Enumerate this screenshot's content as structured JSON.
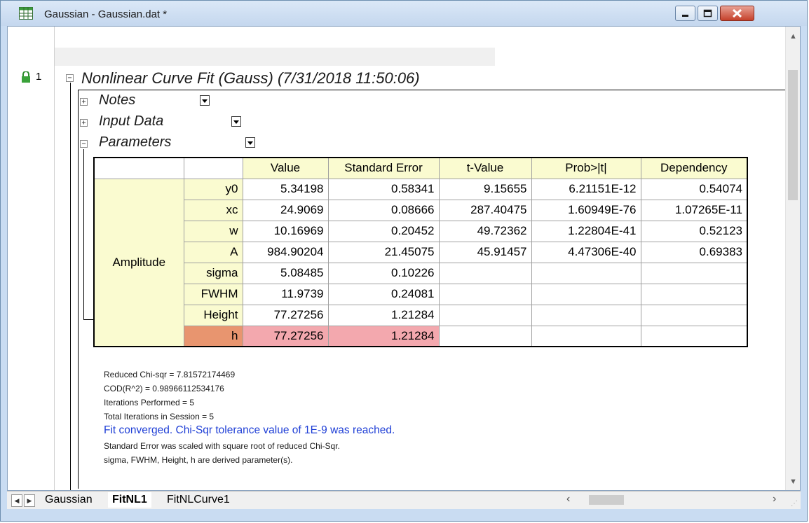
{
  "window": {
    "title": "Gaussian - Gaussian.dat *",
    "min_icon": "minimize-icon",
    "max_icon": "maximize-icon",
    "close_icon": "close-icon"
  },
  "report": {
    "row_number": "1",
    "heading": "Nonlinear Curve Fit (Gauss) (7/31/2018 11:50:06)",
    "sections": {
      "notes": "Notes",
      "input_data": "Input Data",
      "parameters": "Parameters"
    },
    "expand": "+",
    "collapse": "−"
  },
  "table": {
    "headers": [
      "Value",
      "Standard Error",
      "t-Value",
      "Prob>|t|",
      "Dependency"
    ],
    "category": "Amplitude",
    "rows": [
      {
        "name": "y0",
        "value": "5.34198",
        "stderr": "0.58341",
        "t": "9.15655",
        "prob": "6.21151E-12",
        "dep": "0.54074"
      },
      {
        "name": "xc",
        "value": "24.9069",
        "stderr": "0.08666",
        "t": "287.40475",
        "prob": "1.60949E-76",
        "dep": "1.07265E-11"
      },
      {
        "name": "w",
        "value": "10.16969",
        "stderr": "0.20452",
        "t": "49.72362",
        "prob": "1.22804E-41",
        "dep": "0.52123"
      },
      {
        "name": "A",
        "value": "984.90204",
        "stderr": "21.45075",
        "t": "45.91457",
        "prob": "4.47306E-40",
        "dep": "0.69383"
      },
      {
        "name": "sigma",
        "value": "5.08485",
        "stderr": "0.10226",
        "t": "",
        "prob": "",
        "dep": ""
      },
      {
        "name": "FWHM",
        "value": "11.9739",
        "stderr": "0.24081",
        "t": "",
        "prob": "",
        "dep": ""
      },
      {
        "name": "Height",
        "value": "77.27256",
        "stderr": "1.21284",
        "t": "",
        "prob": "",
        "dep": ""
      },
      {
        "name": "h",
        "value": "77.27256",
        "stderr": "1.21284",
        "t": "",
        "prob": "",
        "dep": ""
      }
    ]
  },
  "notes": {
    "line1": "Reduced Chi-sqr = 7.81572174469",
    "line2": "COD(R^2) = 0.98966112534176",
    "line3": "Iterations Performed = 5",
    "line4": "Total Iterations in Session = 5",
    "converged": "Fit converged. Chi-Sqr tolerance value of 1E-9 was reached.",
    "line6": "Standard Error was scaled with square root of reduced Chi-Sqr.",
    "line7": "sigma, FWHM, Height, h are derived parameter(s)."
  },
  "tabs": [
    "Gaussian",
    "FitNL1",
    "FitNLCurve1"
  ],
  "colors": {
    "header_bg": "#fafbd0",
    "highlight_name": "#e8956f",
    "highlight_value": "#f3a8ae",
    "converged_text": "#1f3fd6"
  }
}
